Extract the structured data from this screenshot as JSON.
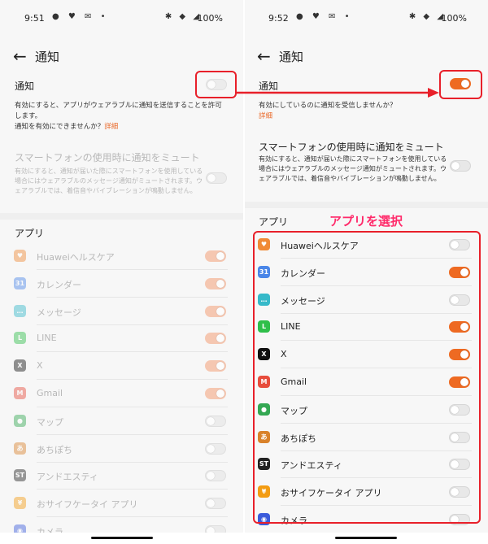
{
  "left": {
    "status": {
      "time": "9:51",
      "battery": "100%"
    },
    "header": {
      "title": "通知"
    },
    "notify": {
      "label": "通知",
      "enabled": false,
      "desc1": "有効にすると、アプリがウェアラブルに通知を送信することを許可します。",
      "desc2": "通知を有効にできませんか？",
      "link": "詳細"
    },
    "mute": {
      "title": "スマートフォンの使用時に通知をミュート",
      "desc": "有効にすると、通知が届いた際にスマートフォンを使用している場合にはウェアラブルのメッセージ通知がミュートされます。ウェアラブルでは、着信音やバイブレーションが鳴動しません。",
      "enabled": false
    },
    "apps_title": "アプリ",
    "apps": [
      {
        "name": "Huaweiヘルスケア",
        "on": true,
        "icon": "huawei-health-icon",
        "color": "#f08a36",
        "glyph": "♥"
      },
      {
        "name": "カレンダー",
        "on": true,
        "icon": "calendar-icon",
        "color": "#4a86e8",
        "glyph": "31"
      },
      {
        "name": "メッセージ",
        "on": true,
        "icon": "message-icon",
        "color": "#36b9c9",
        "glyph": "…"
      },
      {
        "name": "LINE",
        "on": true,
        "icon": "line-icon",
        "color": "#2fbf4a",
        "glyph": "L"
      },
      {
        "name": "X",
        "on": true,
        "icon": "x-icon",
        "color": "#111111",
        "glyph": "X"
      },
      {
        "name": "Gmail",
        "on": true,
        "icon": "gmail-icon",
        "color": "#e74c3c",
        "glyph": "M"
      },
      {
        "name": "マップ",
        "on": false,
        "icon": "map-icon",
        "color": "#34a853",
        "glyph": "●"
      },
      {
        "name": "あちぽち",
        "on": false,
        "icon": "achipochi-icon",
        "color": "#d9822b",
        "glyph": "あ"
      },
      {
        "name": "アンドエスティ",
        "on": false,
        "icon": "andst-icon",
        "color": "#222222",
        "glyph": "ST"
      },
      {
        "name": "おサイフケータイ アプリ",
        "on": false,
        "icon": "osaifu-icon",
        "color": "#f39c12",
        "glyph": "¥"
      },
      {
        "name": "カメラ",
        "on": false,
        "icon": "camera-icon",
        "color": "#3b5bdb",
        "glyph": "◉"
      }
    ]
  },
  "right": {
    "status": {
      "time": "9:52",
      "battery": "100%"
    },
    "header": {
      "title": "通知"
    },
    "notify": {
      "label": "通知",
      "enabled": true,
      "desc1": "有効にしているのに通知を受信しませんか？",
      "link": "詳細"
    },
    "mute": {
      "title": "スマートフォンの使用時に通知をミュート",
      "desc": "有効にすると、通知が届いた際にスマートフォンを使用している場合にはウェアラブルのメッセージ通知がミュートされます。ウェアラブルでは、着信音やバイブレーションが鳴動しません。",
      "enabled": false
    },
    "apps_title": "アプリ",
    "annotation": "アプリを選択",
    "apps": [
      {
        "name": "Huaweiヘルスケア",
        "on": false,
        "icon": "huawei-health-icon",
        "color": "#f08a36",
        "glyph": "♥"
      },
      {
        "name": "カレンダー",
        "on": true,
        "icon": "calendar-icon",
        "color": "#4a86e8",
        "glyph": "31"
      },
      {
        "name": "メッセージ",
        "on": false,
        "icon": "message-icon",
        "color": "#36b9c9",
        "glyph": "…"
      },
      {
        "name": "LINE",
        "on": true,
        "icon": "line-icon",
        "color": "#2fbf4a",
        "glyph": "L"
      },
      {
        "name": "X",
        "on": true,
        "icon": "x-icon",
        "color": "#111111",
        "glyph": "X"
      },
      {
        "name": "Gmail",
        "on": true,
        "icon": "gmail-icon",
        "color": "#e74c3c",
        "glyph": "M"
      },
      {
        "name": "マップ",
        "on": false,
        "icon": "map-icon",
        "color": "#34a853",
        "glyph": "●"
      },
      {
        "name": "あちぽち",
        "on": false,
        "icon": "achipochi-icon",
        "color": "#d9822b",
        "glyph": "あ"
      },
      {
        "name": "アンドエスティ",
        "on": false,
        "icon": "andst-icon",
        "color": "#222222",
        "glyph": "ST"
      },
      {
        "name": "おサイフケータイ アプリ",
        "on": false,
        "icon": "osaifu-icon",
        "color": "#f39c12",
        "glyph": "¥"
      },
      {
        "name": "カメラ",
        "on": false,
        "icon": "camera-icon",
        "color": "#3b5bdb",
        "glyph": "◉"
      }
    ]
  },
  "colors": {
    "accent": "#ee6a22",
    "highlight": "#e8202a",
    "annotation": "#ff2a6a"
  }
}
